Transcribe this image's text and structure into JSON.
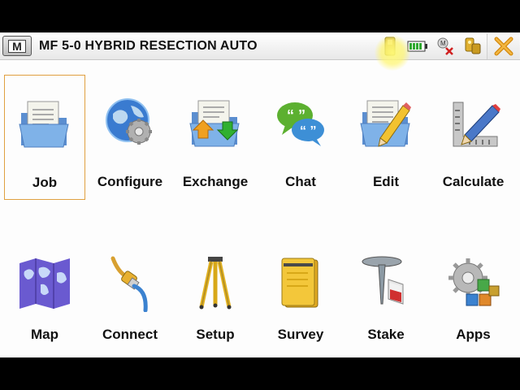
{
  "titlebar": {
    "menu_label": "M",
    "title": "MF 5-0 HYBRID RESECTION AUTO"
  },
  "status_icons": [
    "receiver-icon",
    "battery-icon",
    "radio-disconnected-icon",
    "survey-style-icon"
  ],
  "close_label": "close",
  "apps": [
    {
      "label": "Job",
      "icon": "job-folder-icon"
    },
    {
      "label": "Configure",
      "icon": "configure-globe-gear-icon"
    },
    {
      "label": "Exchange",
      "icon": "exchange-folder-arrows-icon"
    },
    {
      "label": "Chat",
      "icon": "chat-bubbles-icon"
    },
    {
      "label": "Edit",
      "icon": "edit-folder-pencil-icon"
    },
    {
      "label": "Calculate",
      "icon": "calculate-pencil-square-icon"
    },
    {
      "label": "Map",
      "icon": "map-icon"
    },
    {
      "label": "Connect",
      "icon": "connect-cable-icon"
    },
    {
      "label": "Setup",
      "icon": "tripod-icon"
    },
    {
      "label": "Survey",
      "icon": "survey-notebook-icon"
    },
    {
      "label": "Stake",
      "icon": "stake-pin-icon"
    },
    {
      "label": "Apps",
      "icon": "apps-gear-blocks-icon"
    }
  ],
  "colors": {
    "selection_border": "#e0a040",
    "folder_blue": "#6aa0d8",
    "arrow_orange": "#f0a020",
    "arrow_green": "#30b030"
  }
}
